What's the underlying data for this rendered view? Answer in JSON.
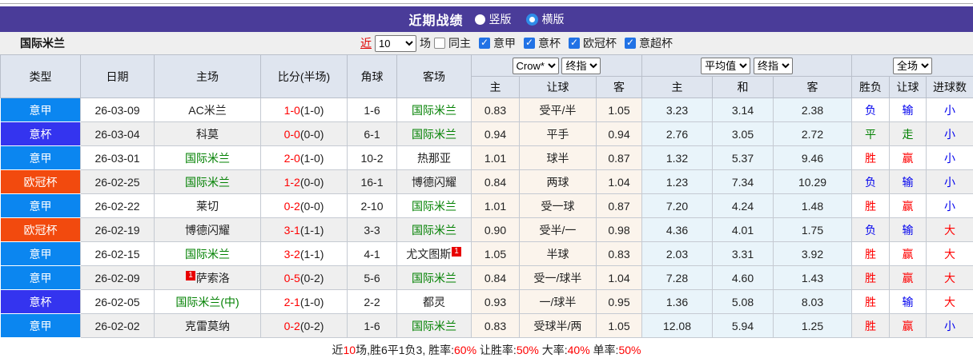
{
  "title_bar": {
    "title": "近期战绩",
    "radio_vertical": "竖版",
    "radio_horizontal": "横版"
  },
  "filter": {
    "near": "近",
    "count": "10",
    "games": "场",
    "same_home": "同主",
    "leagues": [
      "意甲",
      "意杯",
      "欧冠杯",
      "意超杯"
    ]
  },
  "team": "国际米兰",
  "header": {
    "left": [
      "类型",
      "日期",
      "主场",
      "比分(半场)",
      "角球",
      "客场"
    ],
    "dd": {
      "crow": "Crow*",
      "final1": "终指",
      "avg": "平均值",
      "final2": "终指",
      "full": "全场"
    },
    "sub": [
      "主",
      "让球",
      "客",
      "主",
      "和",
      "客",
      "胜负",
      "让球",
      "进球数"
    ]
  },
  "rows": [
    {
      "type": "意甲",
      "date": "26-03-09",
      "home": "AC米兰",
      "score": "1-0",
      "half": "(1-0)",
      "corner": "1-6",
      "away": "国际米兰",
      "o1": "0.83",
      "handicap": "受平/半",
      "o2": "1.05",
      "a1": "3.23",
      "a2": "3.14",
      "a3": "2.38",
      "wl": "负",
      "hr": "输",
      "goal": "小"
    },
    {
      "type": "意杯",
      "date": "26-03-04",
      "home": "科莫",
      "score": "0-0",
      "half": "(0-0)",
      "corner": "6-1",
      "away": "国际米兰",
      "o1": "0.94",
      "handicap": "平手",
      "o2": "0.94",
      "a1": "2.76",
      "a2": "3.05",
      "a3": "2.72",
      "wl": "平",
      "hr": "走",
      "goal": "小"
    },
    {
      "type": "意甲",
      "date": "26-03-01",
      "home": "国际米兰",
      "score": "2-0",
      "half": "(1-0)",
      "corner": "10-2",
      "away": "热那亚",
      "o1": "1.01",
      "handicap": "球半",
      "o2": "0.87",
      "a1": "1.32",
      "a2": "5.37",
      "a3": "9.46",
      "wl": "胜",
      "hr": "赢",
      "goal": "小"
    },
    {
      "type": "欧冠杯",
      "date": "26-02-25",
      "home": "国际米兰",
      "score": "1-2",
      "half": "(0-0)",
      "corner": "16-1",
      "away": "博德闪耀",
      "o1": "0.84",
      "handicap": "两球",
      "o2": "1.04",
      "a1": "1.23",
      "a2": "7.34",
      "a3": "10.29",
      "wl": "负",
      "hr": "输",
      "goal": "小"
    },
    {
      "type": "意甲",
      "date": "26-02-22",
      "home": "莱切",
      "score": "0-2",
      "half": "(0-0)",
      "corner": "2-10",
      "away": "国际米兰",
      "o1": "1.01",
      "handicap": "受一球",
      "o2": "0.87",
      "a1": "7.20",
      "a2": "4.24",
      "a3": "1.48",
      "wl": "胜",
      "hr": "赢",
      "goal": "小"
    },
    {
      "type": "欧冠杯",
      "date": "26-02-19",
      "home": "博德闪耀",
      "score": "3-1",
      "half": "(1-1)",
      "corner": "3-3",
      "away": "国际米兰",
      "o1": "0.90",
      "handicap": "受半/一",
      "o2": "0.98",
      "a1": "4.36",
      "a2": "4.01",
      "a3": "1.75",
      "wl": "负",
      "hr": "输",
      "goal": "大"
    },
    {
      "type": "意甲",
      "date": "26-02-15",
      "home": "国际米兰",
      "score": "3-2",
      "half": "(1-1)",
      "corner": "4-1",
      "away": "尤文图斯",
      "away_card": "1",
      "o1": "1.05",
      "handicap": "半球",
      "o2": "0.83",
      "a1": "2.03",
      "a2": "3.31",
      "a3": "3.92",
      "wl": "胜",
      "hr": "赢",
      "goal": "大"
    },
    {
      "type": "意甲",
      "date": "26-02-09",
      "home": "萨索洛",
      "home_card": "1",
      "score": "0-5",
      "half": "(0-2)",
      "corner": "5-6",
      "away": "国际米兰",
      "o1": "0.84",
      "handicap": "受一/球半",
      "o2": "1.04",
      "a1": "7.28",
      "a2": "4.60",
      "a3": "1.43",
      "wl": "胜",
      "hr": "赢",
      "goal": "大"
    },
    {
      "type": "意杯",
      "date": "26-02-05",
      "home": "国际米兰(中)",
      "score": "2-1",
      "half": "(1-0)",
      "corner": "2-2",
      "away": "都灵",
      "o1": "0.93",
      "handicap": "一/球半",
      "o2": "0.95",
      "a1": "1.36",
      "a2": "5.08",
      "a3": "8.03",
      "wl": "胜",
      "hr": "输",
      "goal": "大"
    },
    {
      "type": "意甲",
      "date": "26-02-02",
      "home": "克雷莫纳",
      "score": "0-2",
      "half": "(0-2)",
      "corner": "1-6",
      "away": "国际米兰",
      "o1": "0.83",
      "handicap": "受球半/两",
      "o2": "1.05",
      "a1": "12.08",
      "a2": "5.94",
      "a3": "1.25",
      "wl": "胜",
      "hr": "赢",
      "goal": "小"
    }
  ],
  "footer": {
    "s1": "近",
    "s2": "10",
    "s3": "场,胜6平1负3, 胜率:",
    "s4": "60%",
    "s5": " 让胜率:",
    "s6": "50%",
    "s7": " 大率:",
    "s8": "40%",
    "s9": " 单率:",
    "s10": "50%"
  },
  "colors": {
    "accent_purple": "#4a3c99",
    "league_serie_a_blue": "#0b86f0",
    "league_coppa_violet": "#3434ef",
    "league_ucl_orange": "#f24a0e",
    "team_green": "#008000",
    "score_red": "#ff0000",
    "win_red": "#ff0000",
    "loss_blue": "#0000ee",
    "draw_green": "#008000",
    "odds_col_bg": "#fbf4ec",
    "avg_col_bg": "#e9f4fa",
    "row_alt_bg": "#efefef",
    "header_bg": "#dfe5ef",
    "checkbox_blue": "#2172e5"
  }
}
